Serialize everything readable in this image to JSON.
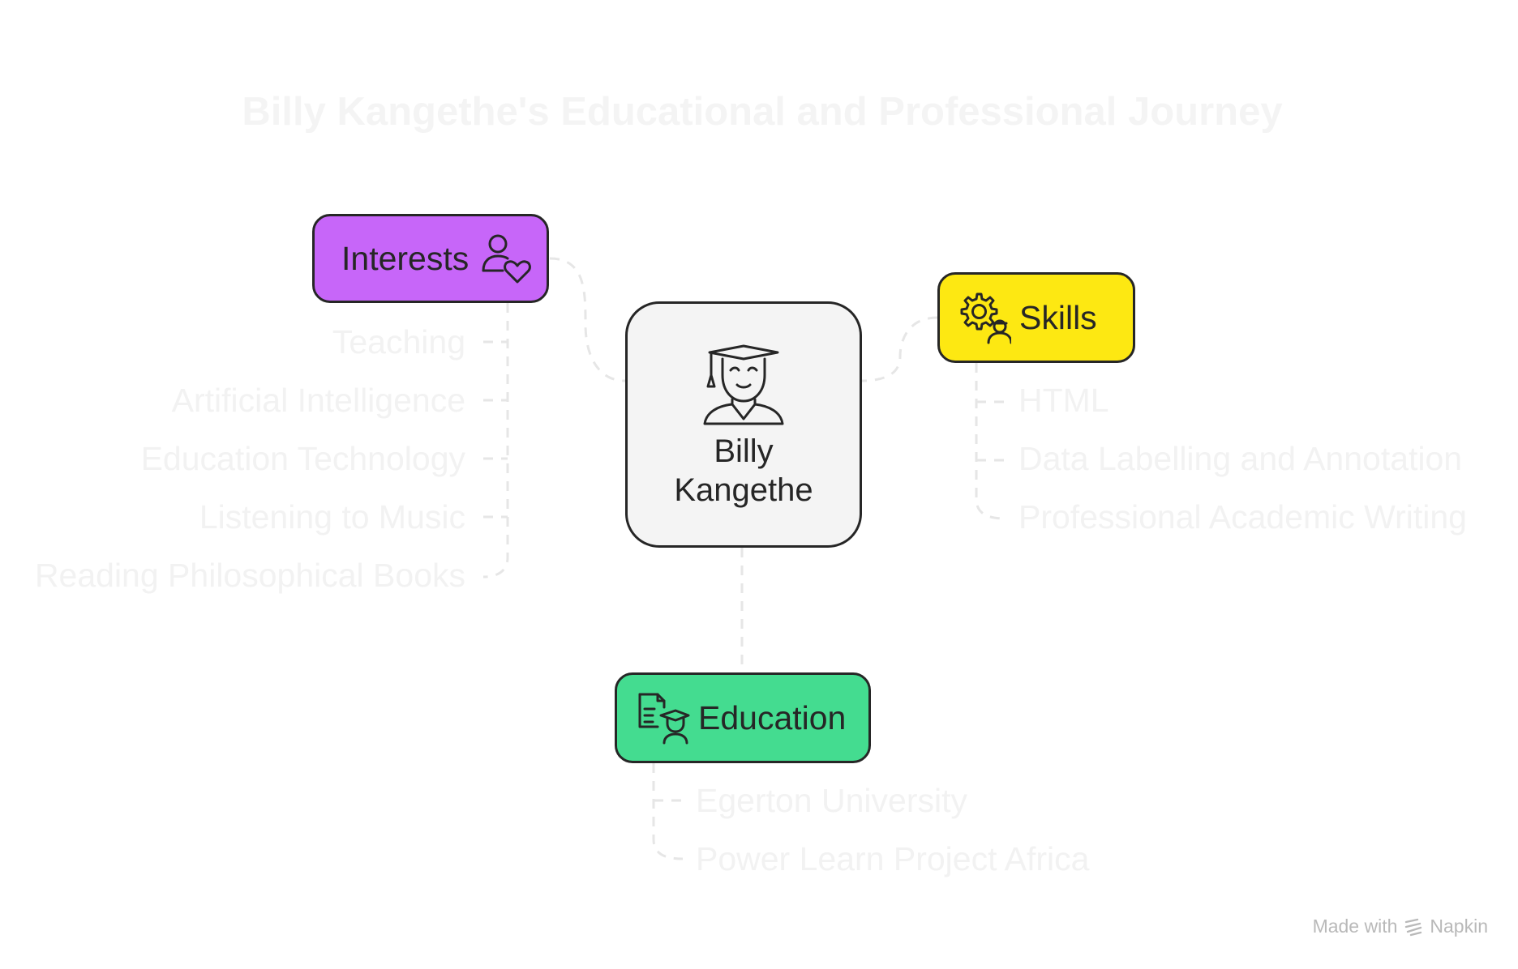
{
  "title": "Billy Kangethe's Educational and Professional Journey",
  "center": {
    "label_line1": "Billy",
    "label_line2": "Kangethe",
    "icon": "graduate-icon"
  },
  "interests": {
    "label": "Interests",
    "icon": "person-heart-icon",
    "color": "#c766f9",
    "items": [
      "Teaching",
      "Artificial Intelligence",
      "Education Technology",
      "Listening to Music",
      "Reading Philosophical Books"
    ]
  },
  "skills": {
    "label": "Skills",
    "icon": "gear-person-icon",
    "color": "#fde812",
    "items": [
      "HTML",
      "Data Labelling and Annotation",
      "Professional Academic Writing"
    ]
  },
  "education": {
    "label": "Education",
    "icon": "document-graduate-icon",
    "color": "#44dc90",
    "items": [
      "Egerton University",
      "Power Learn Project Africa"
    ]
  },
  "footer": {
    "made_with": "Made with",
    "brand": "Napkin",
    "brand_icon": "napkin-logo-icon"
  },
  "colors": {
    "stroke": "#262626",
    "leaf_text": "#f2f2f2",
    "center_fill": "#f4f4f4"
  }
}
